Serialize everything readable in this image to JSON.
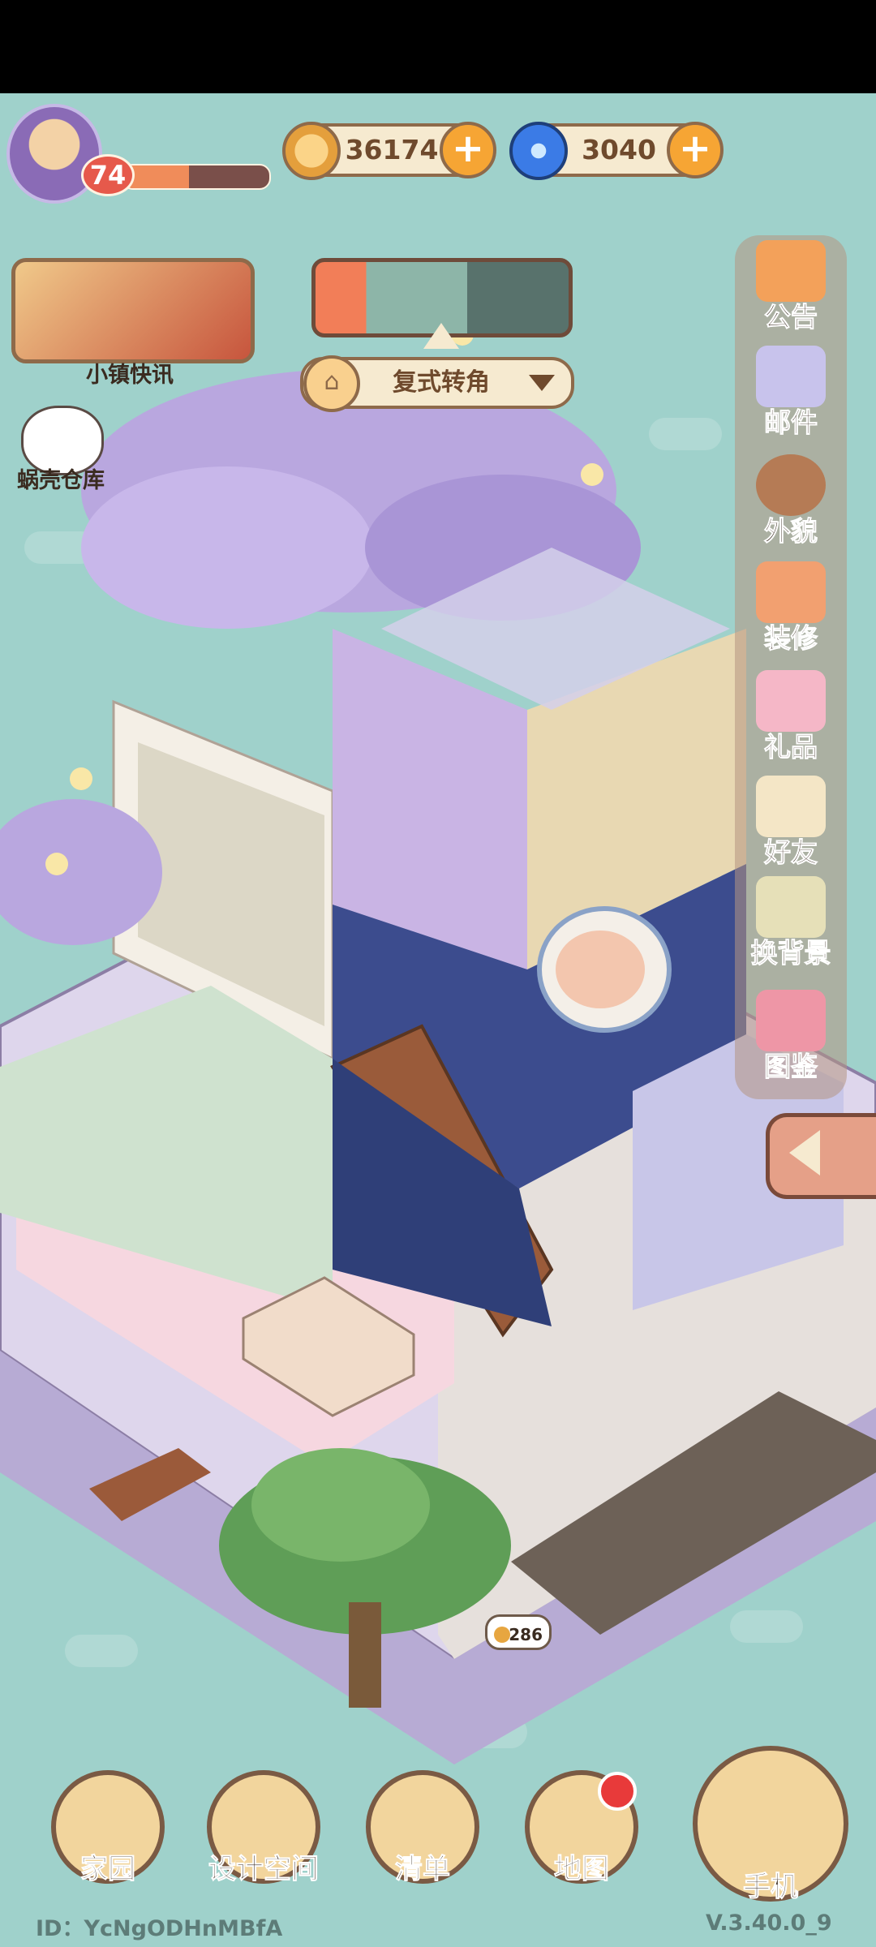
{
  "player": {
    "level": "74",
    "xp_progress": 0.45
  },
  "currencies": [
    {
      "icon": "coin-icon",
      "value": "36174"
    },
    {
      "icon": "gem-icon",
      "value": "3040"
    }
  ],
  "news": {
    "label": "小镇快讯"
  },
  "snail_storage": {
    "label": "蜗壳仓库"
  },
  "layout_selector": {
    "label": "复式转角"
  },
  "side_menu": [
    {
      "icon": "megaphone-icon",
      "label": "公告"
    },
    {
      "icon": "mail-icon",
      "label": "邮件"
    },
    {
      "icon": "character-icon",
      "label": "外貌"
    },
    {
      "icon": "renovate-icon",
      "label": "装修"
    },
    {
      "icon": "gift-icon",
      "label": "礼品"
    },
    {
      "icon": "friends-icon",
      "label": "好友"
    },
    {
      "icon": "background-icon",
      "label": "换背景"
    },
    {
      "icon": "catalog-icon",
      "label": "图鉴"
    }
  ],
  "visitor_bubble": {
    "value": "286"
  },
  "bottom_nav": [
    {
      "icon": "home-icon",
      "label": "家园"
    },
    {
      "icon": "design-icon",
      "label": "设计空间"
    },
    {
      "icon": "list-icon",
      "label": "清单"
    },
    {
      "icon": "map-pin-icon",
      "label": "地图"
    },
    {
      "icon": "phone-icon",
      "label": "手机"
    }
  ],
  "footer": {
    "id": "ID：YcNgODHnMBfA",
    "version": "V.3.40.0_9"
  }
}
